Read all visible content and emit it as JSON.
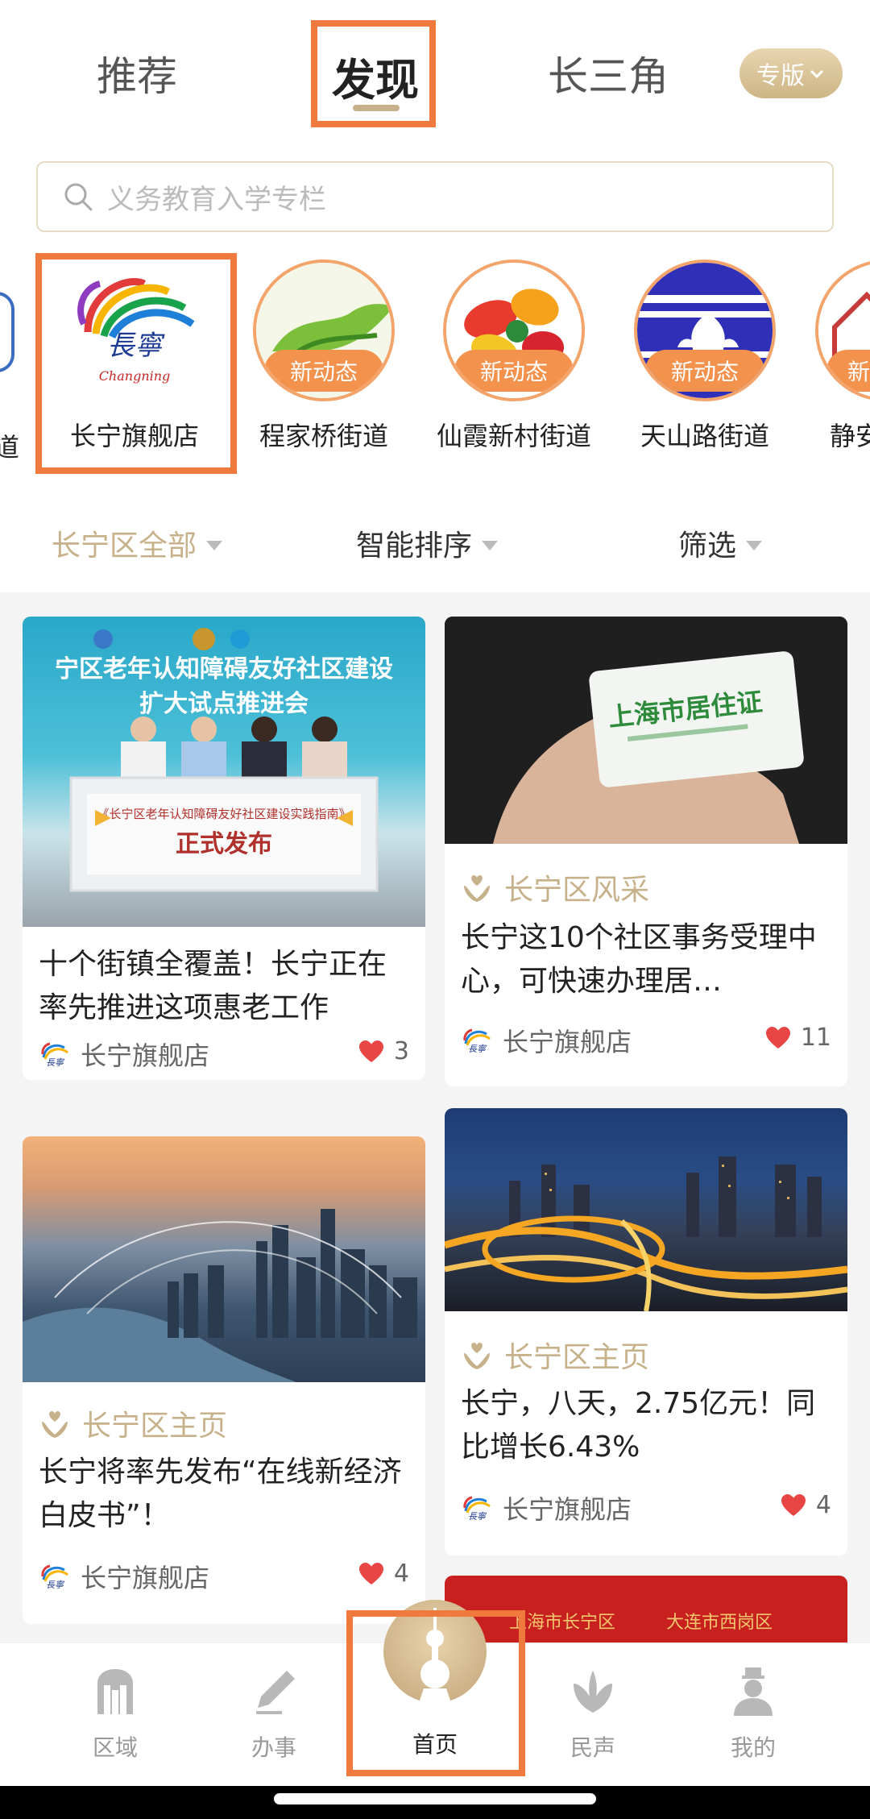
{
  "tabs": [
    {
      "label": "推荐"
    },
    {
      "label": "发现"
    },
    {
      "label": "长三角"
    }
  ],
  "edition_label": "专版",
  "search": {
    "placeholder": "义务教育入学专栏"
  },
  "stores": [
    {
      "name": "长宁旗舰店"
    },
    {
      "name": "程家桥街道",
      "badge": "新动态"
    },
    {
      "name": "仙霞新村街道",
      "badge": "新动态"
    },
    {
      "name": "天山路街道",
      "badge": "新动态"
    },
    {
      "name": "静安",
      "badge": "新"
    }
  ],
  "partial_left_store_tail": "道",
  "filters": [
    {
      "label": "长宁区全部"
    },
    {
      "label": "智能排序"
    },
    {
      "label": "筛选"
    }
  ],
  "cards": [
    {
      "title": "十个街镇全覆盖！长宁正在率先推进这项惠老工作",
      "author": "长宁旗舰店",
      "likes": "3",
      "image_text_1": "宁区老年认知障碍友好社区建设",
      "image_text_2": "扩大试点推进会",
      "image_text_3": "《长宁区老年认知障碍友好社区建设实践指南》",
      "image_text_4": "正式发布"
    },
    {
      "category": "长宁区风采",
      "title": "长宁这10个社区事务受理中心，可快速办理居…",
      "author": "长宁旗舰店",
      "likes": "11",
      "image_text_1": "上海市居住证"
    },
    {
      "category": "长宁区主页",
      "title": "长宁将率先发布“在线新经济白皮书”！",
      "author": "长宁旗舰店",
      "likes": "4"
    },
    {
      "category": "长宁区主页",
      "title": "长宁，八天，2.75亿元！同比增长6.43%",
      "author": "长宁旗舰店",
      "likes": "4"
    },
    {
      "image_text_1": "上海市长宁区",
      "image_text_2": "大连市西岗区"
    }
  ],
  "bottom_nav": [
    {
      "label": "区域",
      "icon": "building-icon"
    },
    {
      "label": "办事",
      "icon": "pen-icon"
    },
    {
      "label": "首页",
      "icon": "home-tower-icon"
    },
    {
      "label": "民声",
      "icon": "hands-icon"
    },
    {
      "label": "我的",
      "icon": "person-icon"
    }
  ],
  "colors": {
    "accent": "#c7b18a",
    "highlight": "#f0793d",
    "badge": "#f3924d",
    "like": "#e84545"
  }
}
